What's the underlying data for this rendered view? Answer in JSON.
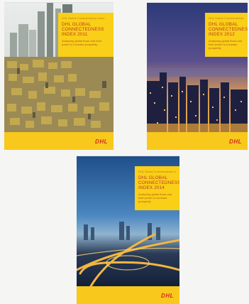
{
  "covers": [
    {
      "kicker": "DHL Global Connectedness Index",
      "title": "DHL GLOBAL CONNECTEDNESS INDEX 2011",
      "subtitle": "Analyzing global flows and their power to increase prosperity",
      "logo": "DHL"
    },
    {
      "kicker": "DHL Global Connectedness Index",
      "title": "DHL GLOBAL CONNECTEDNESS INDEX 2012",
      "subtitle": "Analyzing global flows and their power to increase prosperity",
      "logo": "DHL"
    },
    {
      "kicker": "DHL Global Connectedness Index",
      "title": "DHL GLOBAL CONNECTEDNESS INDEX 2014",
      "subtitle": "Analyzing global flows and their power to increase prosperity",
      "logo": "DHL"
    }
  ],
  "colors": {
    "dhl_yellow": "#f8c81c",
    "dhl_red": "#d22e1e"
  }
}
